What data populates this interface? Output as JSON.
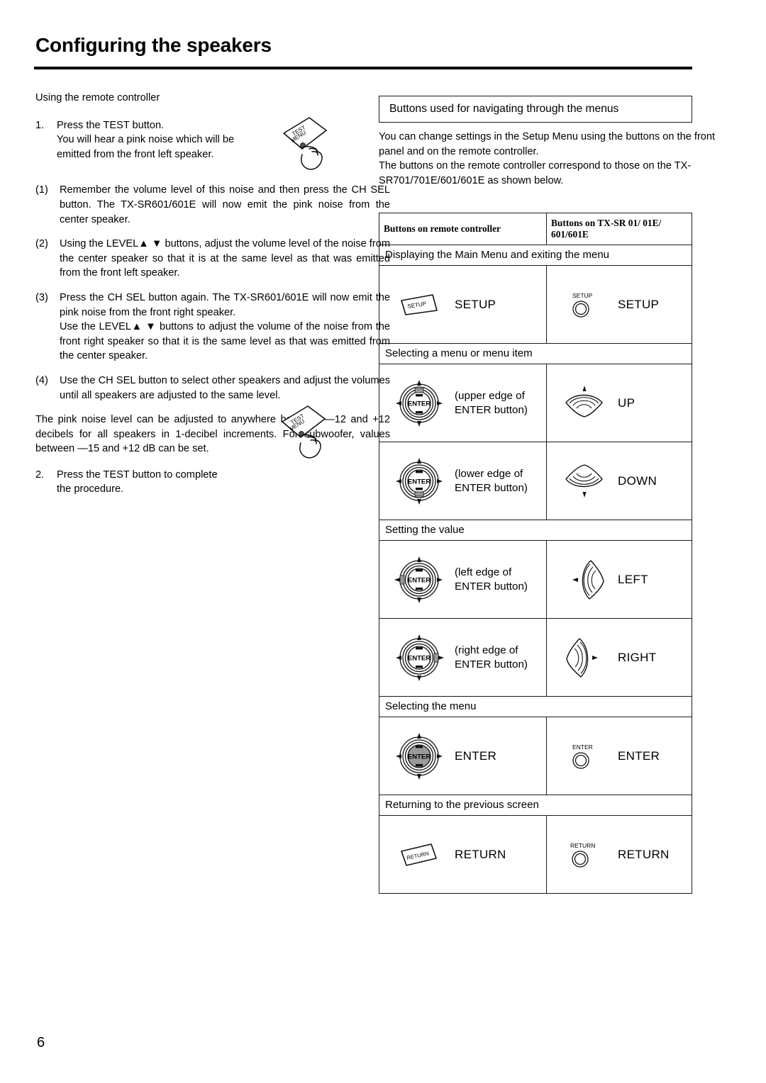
{
  "page": {
    "title": "Configuring the speakers",
    "number": "6"
  },
  "left_column": {
    "intro": "Using the remote controller",
    "steps": [
      {
        "marker": "1.",
        "lines": [
          "Press the TEST button.",
          "You will hear a pink noise which will be",
          "emitted from the front left speaker."
        ]
      }
    ],
    "substeps": [
      {
        "marker": "(1)",
        "text": "Remember the volume level of this noise and then press the CH SEL button. The TX-SR601/601E will now emit the pink noise from the center speaker."
      },
      {
        "marker": "(2)",
        "text": "Using the LEVEL▲ ▼  buttons, adjust the volume level of the noise from the center speaker so that it is at the same level as that was emitted from the front left speaker."
      },
      {
        "marker": "(3)",
        "text": "Press the CH SEL button again. The TX-SR601/601E will now emit the pink noise from the front right speaker.\nUse the LEVEL▲ ▼  buttons to adjust the volume of the noise from the front right speaker so that it is the same level as that was emitted from the center speaker."
      },
      {
        "marker": "(4)",
        "text": "Use the CH SEL button to select other speakers and adjust the volumes until all speakers are adjusted to the same level."
      }
    ],
    "note": "The pink noise level can be adjusted to anywhere between —12 and +12 decibels for all speakers in 1-decibel increments. For subwoofer, values between —15 and +12 dB can be set.",
    "final_step": {
      "marker": "2.",
      "lines": [
        "Press the TEST button to complete",
        "the procedure."
      ]
    }
  },
  "right_column": {
    "box_heading": "Buttons used for navigating through the menus",
    "description": "You can change settings in the Setup Menu using the buttons on the front panel and on the remote controller.\nThe buttons on the remote controller correspond to those on the TX-SR701/701E/601/601E as shown below."
  },
  "table": {
    "header": {
      "left": "Buttons on remote controller",
      "right": "Buttons on TX-SR  01/  01E/\n601/601E"
    },
    "sections": [
      {
        "section_label": "Displaying the Main Menu and exiting the menu",
        "rows": [
          {
            "remote_icon": "setup-remote-button-icon",
            "remote_label": "SETUP",
            "unit_icon": "setup-round-button-icon",
            "unit_icon_caption": "SETUP",
            "unit_label": "SETUP"
          }
        ]
      },
      {
        "section_label": "Selecting a menu or menu item",
        "rows": [
          {
            "remote_icon": "enter-dial-up-icon",
            "remote_label": "(upper edge of\nENTER button)",
            "unit_icon": "fan-up-icon",
            "unit_icon_caption": "",
            "unit_label": "UP"
          },
          {
            "remote_icon": "enter-dial-down-icon",
            "remote_label": "(lower edge of\nENTER button)",
            "unit_icon": "fan-down-icon",
            "unit_icon_caption": "",
            "unit_label": "DOWN"
          }
        ]
      },
      {
        "section_label": "Setting the value",
        "rows": [
          {
            "remote_icon": "enter-dial-left-icon",
            "remote_label": "(left edge of\nENTER button)",
            "unit_icon": "fan-left-icon",
            "unit_icon_caption": "",
            "unit_label": "LEFT"
          },
          {
            "remote_icon": "enter-dial-right-icon",
            "remote_label": "(right edge of\nENTER button)",
            "unit_icon": "fan-right-icon",
            "unit_icon_caption": "",
            "unit_label": "RIGHT"
          }
        ]
      },
      {
        "section_label": "Selecting the menu",
        "rows": [
          {
            "remote_icon": "enter-dial-center-icon",
            "remote_label": "ENTER",
            "unit_icon": "enter-round-button-icon",
            "unit_icon_caption": "ENTER",
            "unit_label": "ENTER"
          }
        ]
      },
      {
        "section_label": "Returning to the previous screen",
        "rows": [
          {
            "remote_icon": "return-remote-button-icon",
            "remote_label": "RETURN",
            "unit_icon": "return-round-button-icon",
            "unit_icon_caption": "RETURN",
            "unit_label": "RETURN"
          }
        ]
      }
    ]
  },
  "icon_text": {
    "setup_key": "SETUP",
    "return_key": "RETURN",
    "enter_key": "ENTER",
    "test_key_line1": "TEST",
    "test_key_line2": "MENU"
  },
  "colors": {
    "ink": "#000000",
    "rule": "#1a1a1a",
    "highlight_gray": "#9a9a9a"
  }
}
